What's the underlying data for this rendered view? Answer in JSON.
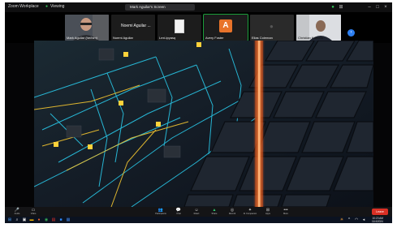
{
  "topbar": {
    "app_label": "Zoom Workplace",
    "share_status": "Viewing",
    "presenter_title": "Mark Aguilar's Screen",
    "window_controls": [
      "minimize-icon",
      "maximize-icon",
      "close-icon"
    ]
  },
  "participants": [
    {
      "name": "Mark Aguilar (he/him)",
      "kind": "camera"
    },
    {
      "name": "Noemi Aguilar",
      "label": "Noemi Aguilar ...",
      "kind": "text"
    },
    {
      "name": "Lexi-ipyasq",
      "kind": "document"
    },
    {
      "name": "Avery Foster",
      "initial": "A",
      "kind": "avatar",
      "active": true
    },
    {
      "name": "Elias Coleman",
      "kind": "blank"
    },
    {
      "name": "Christian Kareem",
      "kind": "camera"
    }
  ],
  "toolbar": {
    "left": [
      {
        "icon": "microphone-icon",
        "label": "Audio"
      },
      {
        "icon": "video-camera-icon",
        "label": "Video"
      }
    ],
    "center": [
      {
        "icon": "participants-icon",
        "label": "Participants"
      },
      {
        "icon": "chat-icon",
        "label": "Chat"
      },
      {
        "icon": "react-icon",
        "label": "React"
      },
      {
        "icon": "share-icon",
        "label": "Share"
      },
      {
        "icon": "record-icon",
        "label": "Record"
      },
      {
        "icon": "ai-companion-icon",
        "label": "AI Companion"
      },
      {
        "icon": "apps-icon",
        "label": "Apps"
      },
      {
        "icon": "more-icon",
        "label": "More"
      }
    ],
    "end_label": "Leave"
  },
  "taskbar": {
    "time": "10:23 AM",
    "date": "11/4/2024"
  }
}
